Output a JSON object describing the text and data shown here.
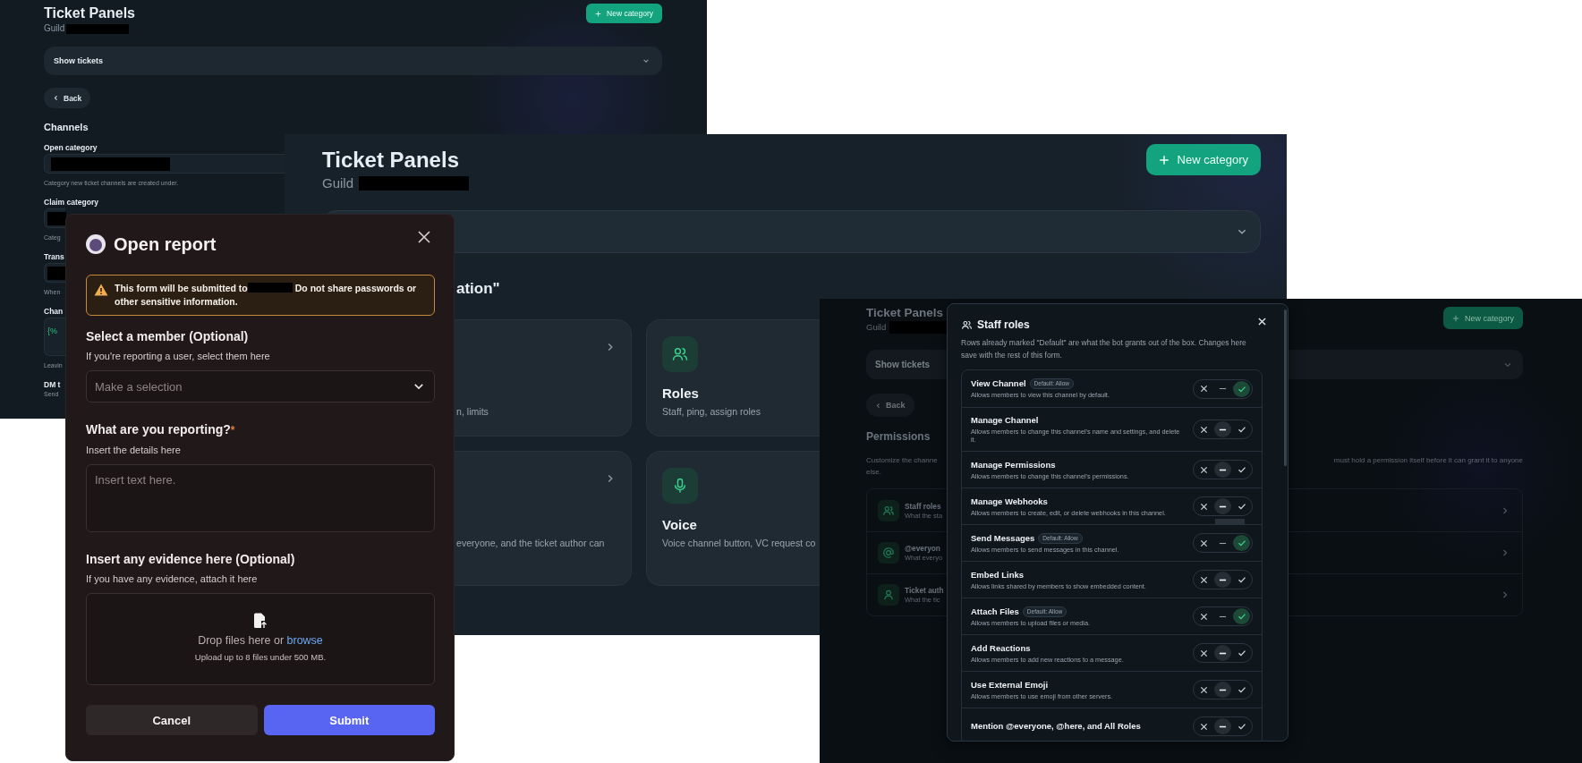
{
  "back_screen": {
    "title": "Ticket Panels",
    "subtitle": {
      "text": "Guild",
      "redacted": true
    },
    "new_button": "New category",
    "dropdown": "Show tickets",
    "back_button": "Back",
    "section": "Channels",
    "fields": [
      {
        "kind": "select",
        "label": "Open category",
        "value_redacted": true,
        "hint": "Category new ticket channels are created under."
      },
      {
        "kind": "select",
        "label": "Claim category",
        "value_redacted": true,
        "hint": "Categ"
      },
      {
        "kind": "select",
        "label": "Trans",
        "value_redacted": true,
        "hint": "When"
      },
      {
        "kind": "code",
        "label": "Chan",
        "value": "{%",
        "hint": "Leavin"
      },
      {
        "kind": "plain",
        "label": "DM t",
        "hint": "Send"
      }
    ]
  },
  "main_screen": {
    "title": "Ticket Panels",
    "subtitle": {
      "text": "Guild",
      "redacted": true
    },
    "new_button": "New category",
    "heading": "ation\"",
    "cards": [
      {
        "kind": "plain",
        "chevron": true,
        "description": "n, limits"
      },
      {
        "kind": "people",
        "chevron": false,
        "title": "Roles",
        "description": "Staff, ping, assign roles"
      },
      {
        "kind": "plain",
        "chevron": true,
        "description": "everyone, and the ticket author can"
      },
      {
        "kind": "mic",
        "chevron": false,
        "title": "Voice",
        "description": "Voice channel button, VC request co"
      }
    ]
  },
  "report_dialog": {
    "title": "Open report",
    "warning": {
      "text_before": "This form will be submitted to",
      "redacted": true,
      "text_after": "Do not share passwords or other sensitive information."
    },
    "fields": [
      {
        "kind": "select",
        "label": "Select a member (Optional)",
        "hint": "If you're reporting a user, select them here",
        "placeholder": "Make a selection"
      },
      {
        "kind": "textarea",
        "label": "What are you reporting?",
        "required_mark": "*",
        "hint": "Insert the details here",
        "placeholder": "Insert text here."
      },
      {
        "kind": "upload",
        "label": "Insert any evidence here (Optional)",
        "hint": "If you have any evidence, attach it here",
        "drop_text": "Drop files here or",
        "link": "browse",
        "limit": "Upload up to 8 files under 500 MB."
      }
    ],
    "buttons": [
      {
        "label": "Cancel",
        "kind": "secondary"
      },
      {
        "label": "Submit",
        "kind": "primary"
      }
    ]
  },
  "permissions_screen": {
    "title": "Ticket Panels",
    "subtitle": {
      "text": "Guild",
      "redacted": true
    },
    "new_button": "New category",
    "dropdown": "Show tickets",
    "back_button": "Back",
    "section": "Permissions",
    "description_start": "Customize the channe",
    "description_wrap": "else.",
    "description_end": "must hold a permission itself before it can grant it to anyone",
    "targets": [
      {
        "kind": "people",
        "title": "Staff roles",
        "subtitle": "What the sta"
      },
      {
        "kind": "at",
        "title": "@everyon",
        "subtitle": "What everyo"
      },
      {
        "kind": "person",
        "title": "Ticket auth",
        "subtitle": "What the tic"
      }
    ],
    "dialog": {
      "title": "Staff roles",
      "description": "Rows already marked \"Default\" are what the bot grants out of the box. Changes here save with the rest of this form.",
      "permissions": [
        {
          "name": "View Channel",
          "badge": "Default: Allow",
          "description": "Allows members to view this channel by default.",
          "allowed": true
        },
        {
          "name": "Manage Channel",
          "description": "Allows members to change this channel's name and settings, and delete it.",
          "allowed": false
        },
        {
          "name": "Manage Permissions",
          "description": "Allows members to change this channel's permissions.",
          "allowed": false
        },
        {
          "name": "Manage Webhooks",
          "description": "Allows members to create, edit, or delete webhooks in this channel.",
          "allowed": false
        },
        {
          "name": "Send Messages",
          "badge": "Default: Allow",
          "description": "Allows members to send messages in this channel.",
          "allowed": true
        },
        {
          "name": "Embed Links",
          "description": "Allows links shared by members to show embedded content.",
          "allowed": false
        },
        {
          "name": "Attach Files",
          "badge": "Default: Allow",
          "description": "Allows members to upload files or media.",
          "allowed": true
        },
        {
          "name": "Add Reactions",
          "description": "Allows members to add new reactions to a message.",
          "allowed": false
        },
        {
          "name": "Use External Emoji",
          "description": "Allows members to use emoji from other servers.",
          "allowed": false
        },
        {
          "name": "Mention @everyone, @here, and All Roles",
          "allowed": false
        }
      ]
    }
  }
}
